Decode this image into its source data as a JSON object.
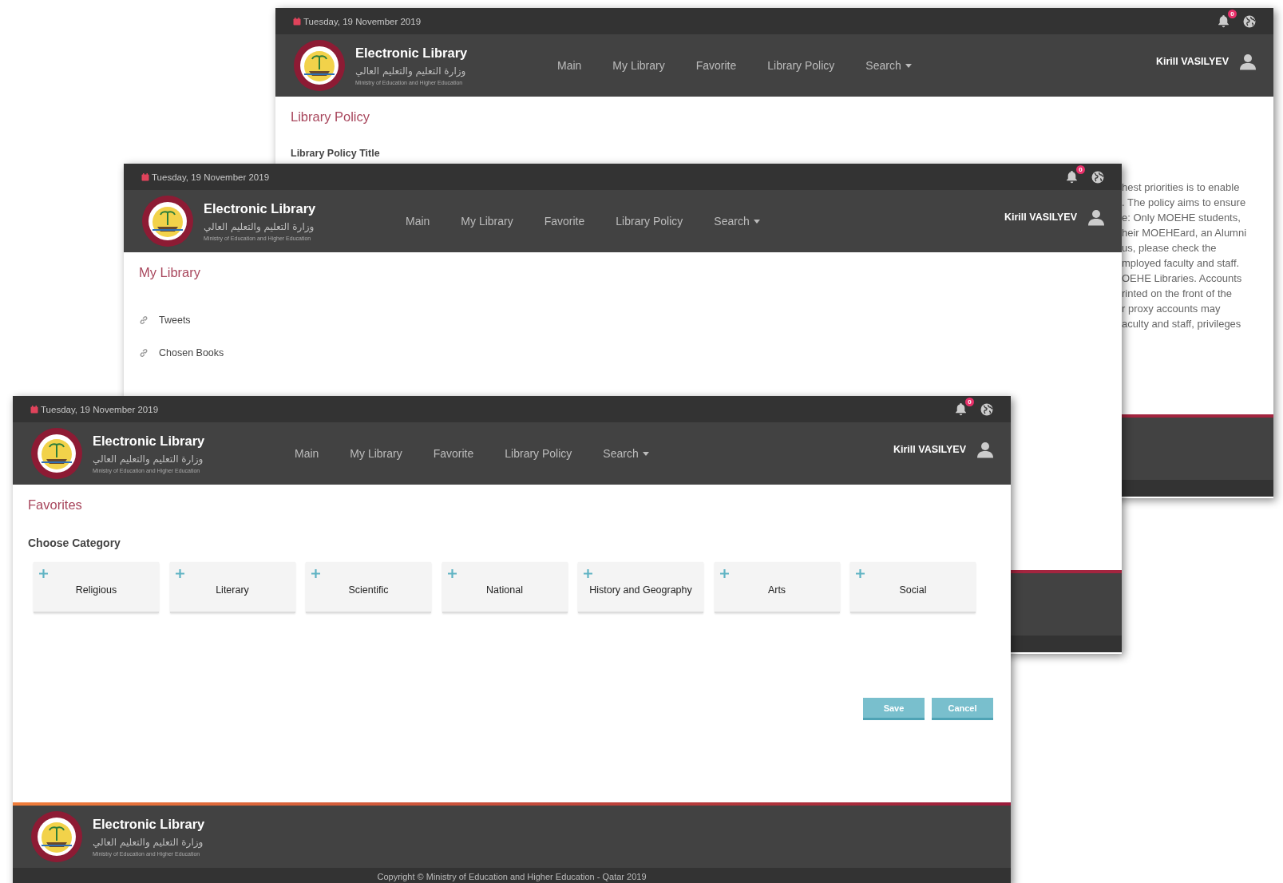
{
  "windows": [
    {
      "kind": "policy",
      "date": "Tuesday, 19 November 2019",
      "notification_count": "0",
      "brand": {
        "title": "Electronic Library",
        "arabic": "وزارة التعليم والتعليم العالي",
        "subtitle": "Ministry of Education and Higher Education"
      },
      "nav": [
        {
          "label": "Main",
          "dropdown": false
        },
        {
          "label": "My Library",
          "dropdown": false
        },
        {
          "label": "Favorite",
          "dropdown": false
        },
        {
          "label": "Library Policy",
          "dropdown": false
        },
        {
          "label": "Search",
          "dropdown": true
        }
      ],
      "user": "Kirill VASILYEV",
      "page_title": "Library Policy",
      "section_title": "Library Policy Title",
      "paragraph_lines": [
        "hest priorities is to enable",
        ". The policy aims to ensure",
        "e: Only MOEHE students,",
        "heir MOEHEard, an Alumni",
        "us, please check the",
        "mployed faculty and staff.",
        "OEHE Libraries. Accounts",
        "rinted on the front of the",
        "r proxy accounts may",
        "aculty and staff, privileges"
      ]
    },
    {
      "kind": "links",
      "date": "Tuesday, 19 November 2019",
      "notification_count": "0",
      "brand": {
        "title": "Electronic Library",
        "arabic": "وزارة التعليم والتعليم العالي",
        "subtitle": "Ministry of Education and Higher Education"
      },
      "nav": [
        {
          "label": "Main",
          "dropdown": false
        },
        {
          "label": "My Library",
          "dropdown": false
        },
        {
          "label": "Favorite",
          "dropdown": false
        },
        {
          "label": "Library Policy",
          "dropdown": false
        },
        {
          "label": "Search",
          "dropdown": true
        }
      ],
      "user": "Kirill VASILYEV",
      "page_title": "My Library",
      "links": [
        "Tweets",
        "Chosen Books"
      ]
    },
    {
      "kind": "favorites",
      "date": "Tuesday, 19 November 2019",
      "notification_count": "0",
      "brand": {
        "title": "Electronic Library",
        "arabic": "وزارة التعليم والتعليم العالي",
        "subtitle": "Ministry of Education and Higher Education"
      },
      "nav": [
        {
          "label": "Main",
          "dropdown": false
        },
        {
          "label": "My Library",
          "dropdown": false
        },
        {
          "label": "Favorite",
          "dropdown": false
        },
        {
          "label": "Library Policy",
          "dropdown": false
        },
        {
          "label": "Search",
          "dropdown": true
        }
      ],
      "user": "Kirill VASILYEV",
      "page_title": "Favorites",
      "section_title": "Choose Category",
      "categories": [
        "Religious",
        "Literary",
        "Scientific",
        "National",
        "History and Geography",
        "Arts",
        "Social"
      ],
      "buttons": [
        "Save",
        "Cancel"
      ],
      "footer": {
        "title": "Electronic Library",
        "arabic": "وزارة التعليم والتعليم العالي",
        "subtitle": "Ministry of Education and Higher Education",
        "copyright": "Copyright © Ministry of Education and Higher Education - Qatar 2019"
      }
    }
  ]
}
